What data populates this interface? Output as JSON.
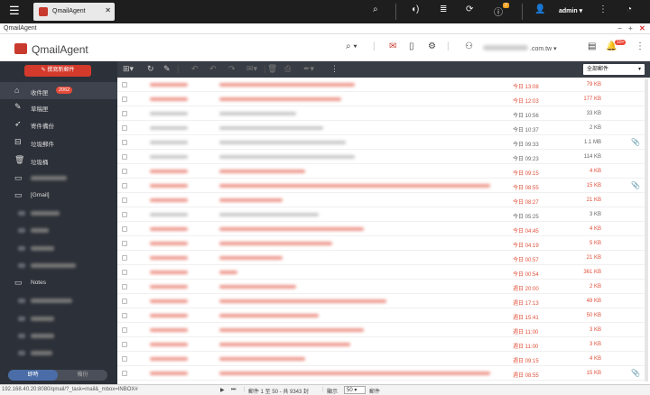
{
  "titlebar": {
    "browser_tab": "QmailAgent",
    "user": "admin",
    "info_badge": "2"
  },
  "window": {
    "title": "QmailAgent"
  },
  "header": {
    "app_name": "QmailAgent",
    "account_suffix": ".com.tw",
    "notify_badge": "10+"
  },
  "sidebar": {
    "compose": "撰寫新郵件",
    "items": [
      {
        "label": "收件匣",
        "badge": "2062",
        "icon": "inbox-icon"
      },
      {
        "label": "草稿匣",
        "icon": "pen-icon"
      },
      {
        "label": "寄件備份",
        "icon": "send-icon"
      },
      {
        "label": "垃圾郵件",
        "icon": "spam-icon"
      },
      {
        "label": "垃圾桶",
        "icon": "trash-icon"
      },
      {
        "label": "",
        "icon": "folder-icon"
      },
      {
        "label": "[Gmail]",
        "icon": "folder-icon"
      },
      {
        "label": "Notes",
        "icon": "folder-icon"
      }
    ],
    "toggle_on": "即時",
    "toggle_off": "備份"
  },
  "toolbar": {
    "filter": "全部郵件"
  },
  "emails": [
    {
      "date": "今日 13:08",
      "size": "79 KB",
      "unread": true,
      "attach": false,
      "w": 150
    },
    {
      "date": "今日 12:03",
      "size": "177 KB",
      "unread": true,
      "attach": false,
      "w": 135
    },
    {
      "date": "今日 10:56",
      "size": "33 KB",
      "unread": false,
      "attach": false,
      "w": 85
    },
    {
      "date": "今日 10:37",
      "size": "2 KB",
      "unread": false,
      "attach": false,
      "w": 115
    },
    {
      "date": "今日 09:33",
      "size": "1.1 MB",
      "unread": false,
      "attach": true,
      "w": 140
    },
    {
      "date": "今日 09:23",
      "size": "114 KB",
      "unread": false,
      "attach": false,
      "w": 150
    },
    {
      "date": "今日 09:15",
      "size": "4 KB",
      "unread": true,
      "attach": false,
      "w": 95
    },
    {
      "date": "今日 08:55",
      "size": "15 KB",
      "unread": true,
      "attach": true,
      "w": 300
    },
    {
      "date": "今日 08:27",
      "size": "21 KB",
      "unread": true,
      "attach": false,
      "w": 70
    },
    {
      "date": "今日 05:25",
      "size": "3 KB",
      "unread": false,
      "attach": false,
      "w": 110
    },
    {
      "date": "今日 04:45",
      "size": "4 KB",
      "unread": true,
      "attach": false,
      "w": 160
    },
    {
      "date": "今日 04:19",
      "size": "5 KB",
      "unread": true,
      "attach": false,
      "w": 125
    },
    {
      "date": "今日 00:57",
      "size": "21 KB",
      "unread": true,
      "attach": false,
      "w": 70
    },
    {
      "date": "今日 00:54",
      "size": "361 KB",
      "unread": true,
      "attach": false,
      "w": 20
    },
    {
      "date": "週日 20:00",
      "size": "2 KB",
      "unread": true,
      "attach": false,
      "w": 85
    },
    {
      "date": "週日 17:13",
      "size": "48 KB",
      "unread": true,
      "attach": false,
      "w": 185
    },
    {
      "date": "週日 15:41",
      "size": "50 KB",
      "unread": true,
      "attach": false,
      "w": 110
    },
    {
      "date": "週日 11:00",
      "size": "3 KB",
      "unread": true,
      "attach": false,
      "w": 160
    },
    {
      "date": "週日 11:00",
      "size": "3 KB",
      "unread": true,
      "attach": false,
      "w": 145
    },
    {
      "date": "週日 09:15",
      "size": "4 KB",
      "unread": true,
      "attach": false,
      "w": 95
    },
    {
      "date": "週日 08:55",
      "size": "15 KB",
      "unread": true,
      "attach": true,
      "w": 300
    }
  ],
  "statusbar": {
    "url": "192.168.40.20:8080/qmail/?_task=mail&_mbox=INBOX#",
    "range": "郵件 1 至 50 - 共 9343 封",
    "show": "顯示",
    "per_page": "50",
    "unit": "郵件"
  }
}
